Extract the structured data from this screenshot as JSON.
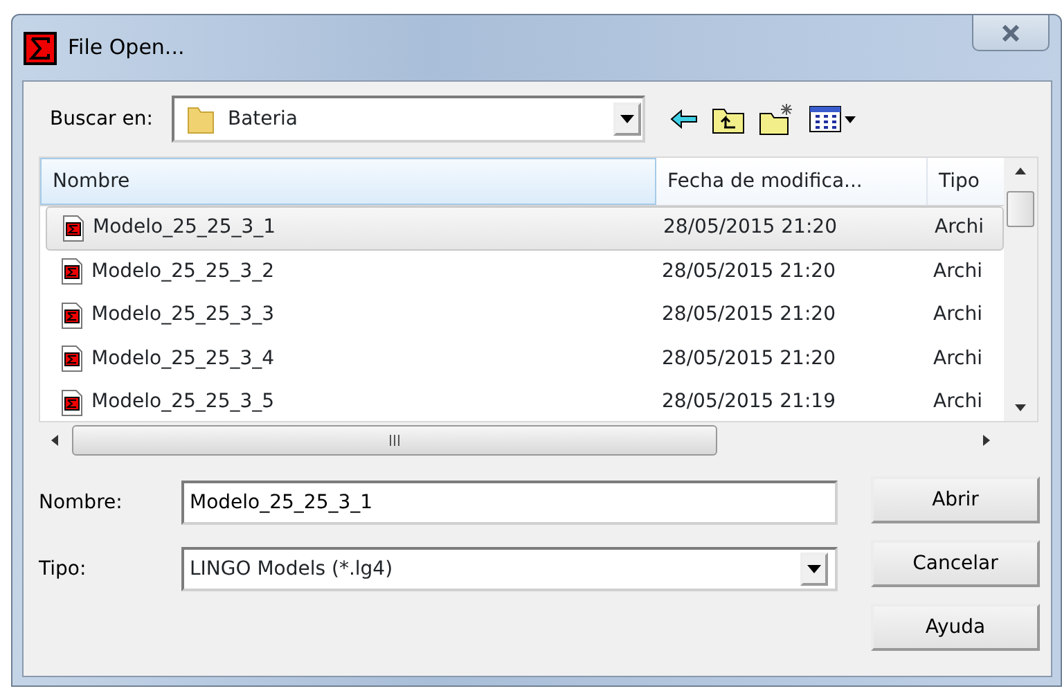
{
  "window": {
    "title": "File Open..."
  },
  "look_in": {
    "label": "Buscar en:",
    "value": "Bateria"
  },
  "file_list": {
    "columns": [
      "Nombre",
      "Fecha de modifica...",
      "Tipo"
    ],
    "rows": [
      {
        "name": "Modelo_25_25_3_1",
        "date": "28/05/2015 21:20",
        "type": "Archi",
        "selected": true
      },
      {
        "name": "Modelo_25_25_3_2",
        "date": "28/05/2015 21:20",
        "type": "Archi",
        "selected": false
      },
      {
        "name": "Modelo_25_25_3_3",
        "date": "28/05/2015 21:20",
        "type": "Archi",
        "selected": false
      },
      {
        "name": "Modelo_25_25_3_4",
        "date": "28/05/2015 21:20",
        "type": "Archi",
        "selected": false
      },
      {
        "name": "Modelo_25_25_3_5",
        "date": "28/05/2015 21:19",
        "type": "Archi",
        "selected": false
      }
    ]
  },
  "file_name": {
    "label": "Nombre:",
    "value": "Modelo_25_25_3_1"
  },
  "file_type": {
    "label": "Tipo:",
    "value": "LINGO Models (*.lg4)"
  },
  "buttons": [
    "Abrir",
    "Cancelar",
    "Ayuda"
  ]
}
